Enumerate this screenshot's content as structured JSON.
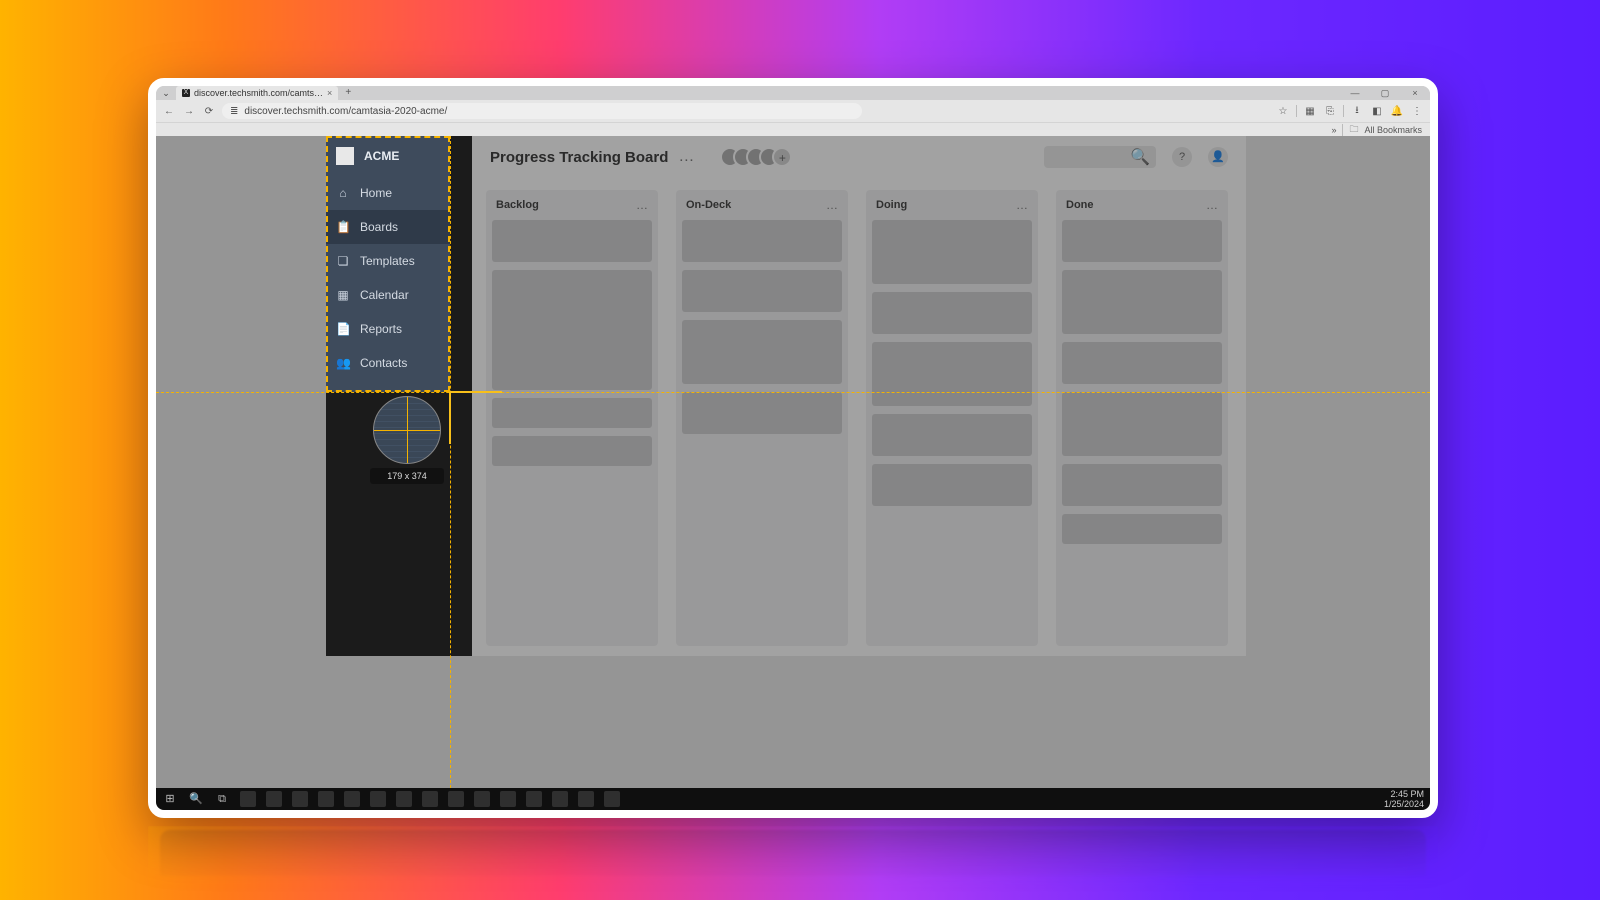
{
  "browser": {
    "tab_arrow": "⌄",
    "tab_title": "discover.techsmith.com/camts…",
    "tab_close": "×",
    "new_tab": "+",
    "win_min": "—",
    "win_max": "▢",
    "win_close": "×",
    "nav_back": "←",
    "nav_fwd": "→",
    "nav_reload": "⟳",
    "url_lock": "≣",
    "url": "discover.techsmith.com/camtasia-2020-acme/",
    "star": "☆",
    "ext1": "▦",
    "ext2": "⎘",
    "dl": "⭳",
    "panel": "◧",
    "bell": "🔔",
    "menu": "⋮",
    "bm_more": "»",
    "bm_folder": "🗀",
    "bm_all": "All Bookmarks"
  },
  "sidebar": {
    "brand": "ACME",
    "items": [
      {
        "icon": "⌂",
        "label": "Home"
      },
      {
        "icon": "📋",
        "label": "Boards"
      },
      {
        "icon": "❏",
        "label": "Templates"
      },
      {
        "icon": "▦",
        "label": "Calendar"
      },
      {
        "icon": "📄",
        "label": "Reports"
      },
      {
        "icon": "👥",
        "label": "Contacts"
      }
    ]
  },
  "board": {
    "title": "Progress Tracking Board",
    "title_dots": "…",
    "add_avatar": "+",
    "help": "?",
    "columns": [
      {
        "title": "Backlog",
        "dots": "…"
      },
      {
        "title": "On-Deck",
        "dots": "…"
      },
      {
        "title": "Doing",
        "dots": "…"
      },
      {
        "title": "Done",
        "dots": "…"
      }
    ]
  },
  "capture": {
    "dimensions": "179 x 374"
  },
  "taskbar": {
    "time": "2:45 PM",
    "date": "1/25/2024"
  }
}
